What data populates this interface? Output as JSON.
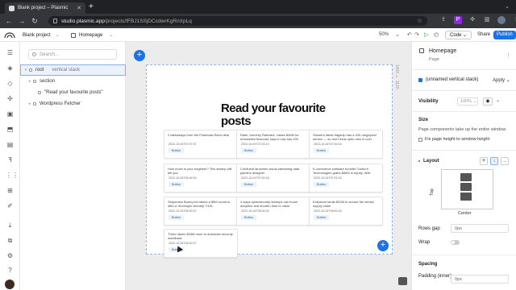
{
  "browser": {
    "tab_title": "Blank project – Plasmic",
    "url_host": "studio.plasmic.app",
    "url_path": "/projects/fFBJ1SSjDCcdwrKgRnXpLq"
  },
  "toolbar": {
    "project_name": "Blank project",
    "page_name": "Homepage",
    "zoom": "50%",
    "code_label": "Code",
    "share_label": "Share",
    "publish_label": "Publish"
  },
  "outline": {
    "search_placeholder": "Search...",
    "items": [
      {
        "label": "root",
        "tag": "vertical stack"
      },
      {
        "label": "section",
        "tag": ""
      },
      {
        "label": "\"Read your favourite posts\"",
        "tag": ""
      },
      {
        "label": "Wordpress Fetcher",
        "tag": ""
      }
    ]
  },
  "canvas": {
    "frame_label": "1440 × 1120",
    "headline": "Read your favourite posts",
    "button_label": "Button",
    "cards": [
      {
        "title": "2 takeaways from the Postmark-Ravel deal",
        "date": "2022-10-04T07:07:37"
      },
      {
        "title": "Rabir, formerly Ratewire, raises $46M for embedded financial, says it now has 200 customers",
        "date": "2022-10-04T07:03:19"
      },
      {
        "title": "Xiaomi's latest flagship has a 200-megapixel sensor — so don't think optic race is over",
        "date": "2022-10-04T07:00:16"
      },
      {
        "title": "How much is your engineer? This startup will tell you",
        "date": "2022-10-04T06:40:34"
      },
      {
        "title": "Confluent launches visual streaming data pipeline designer",
        "date": "2022-10-04T07:00:18"
      },
      {
        "title": "E-commerce software bundler CartonX Technologies grabs $80M in equity, debt",
        "date": "2022-10-04T07:01:03"
      },
      {
        "title": "Sequenzio Bunny.net raises a $9M round to offer a 'developer-friendly' CDN",
        "date": "2022-10-04T06:00:37"
      },
      {
        "title": "4 ways cybersecurity startups can boost adoption and shorten time to value",
        "date": "2022-10-04T06:00:34"
      },
      {
        "title": "Eclipsium lands $20M to secure the device supply chain",
        "date": "2022-10-04T06:00:16"
      },
      {
        "title": "Three raises $33M more to automate security workflows",
        "date": "2022-10-04T06:00:27"
      }
    ]
  },
  "inspector": {
    "title": "Homepage",
    "subtitle": "Page",
    "element_name": "(unnamed vertical stack)",
    "apply_label": "Apply",
    "visibility_label": "Visibility",
    "visibility_value": "100%",
    "size_label": "Size",
    "size_description": "Page components take up the entire window.",
    "fix_page_height_label": "Fix page height to window height",
    "layout_label": "Layout",
    "align_vertical_label": "Top",
    "align_horizontal_label": "Center",
    "rows_gap_label": "Rows gap",
    "rows_gap_value": "0px",
    "wrap_label": "Wrap",
    "wrap_enabled": false,
    "spacing_label": "Spacing",
    "padding_label": "Padding (inner)",
    "padding_value": "0px"
  },
  "colors": {
    "accent": "#1a73e8",
    "browser_dark": "#202124"
  },
  "icons": [
    "plasmic-logo-icon",
    "search-icon",
    "plus-icon",
    "eye-icon",
    "chat-icon"
  ]
}
